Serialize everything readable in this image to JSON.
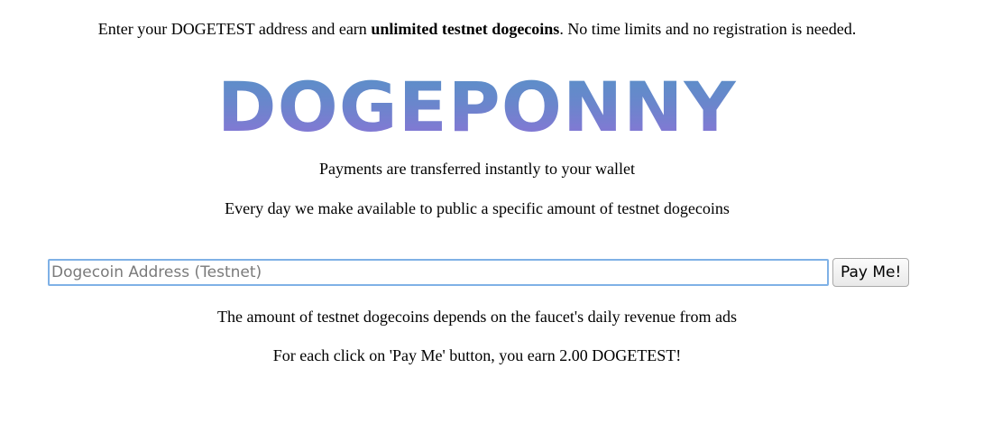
{
  "intro": {
    "prefix": "Enter your DOGETEST address and earn ",
    "bold": "unlimited testnet dogecoins",
    "suffix": ". No time limits and no registration is needed."
  },
  "logo": {
    "text": "DOGEPONNY",
    "gradient_colors": [
      "#5a90c8",
      "#8a74d6"
    ]
  },
  "info_lines": {
    "payments": "Payments are transferred instantly to your wallet",
    "daily": "Every day we make available to public a specific amount of testnet dogecoins",
    "amount": "The amount of testnet dogecoins depends on the faucet's daily revenue from ads",
    "earn": "For each click on 'Pay Me' button, you earn 2.00 DOGETEST!"
  },
  "form": {
    "address_placeholder": "Dogecoin Address (Testnet)",
    "address_value": "",
    "pay_button_label": "Pay Me!",
    "input_border_color": "#7fb1e6"
  }
}
